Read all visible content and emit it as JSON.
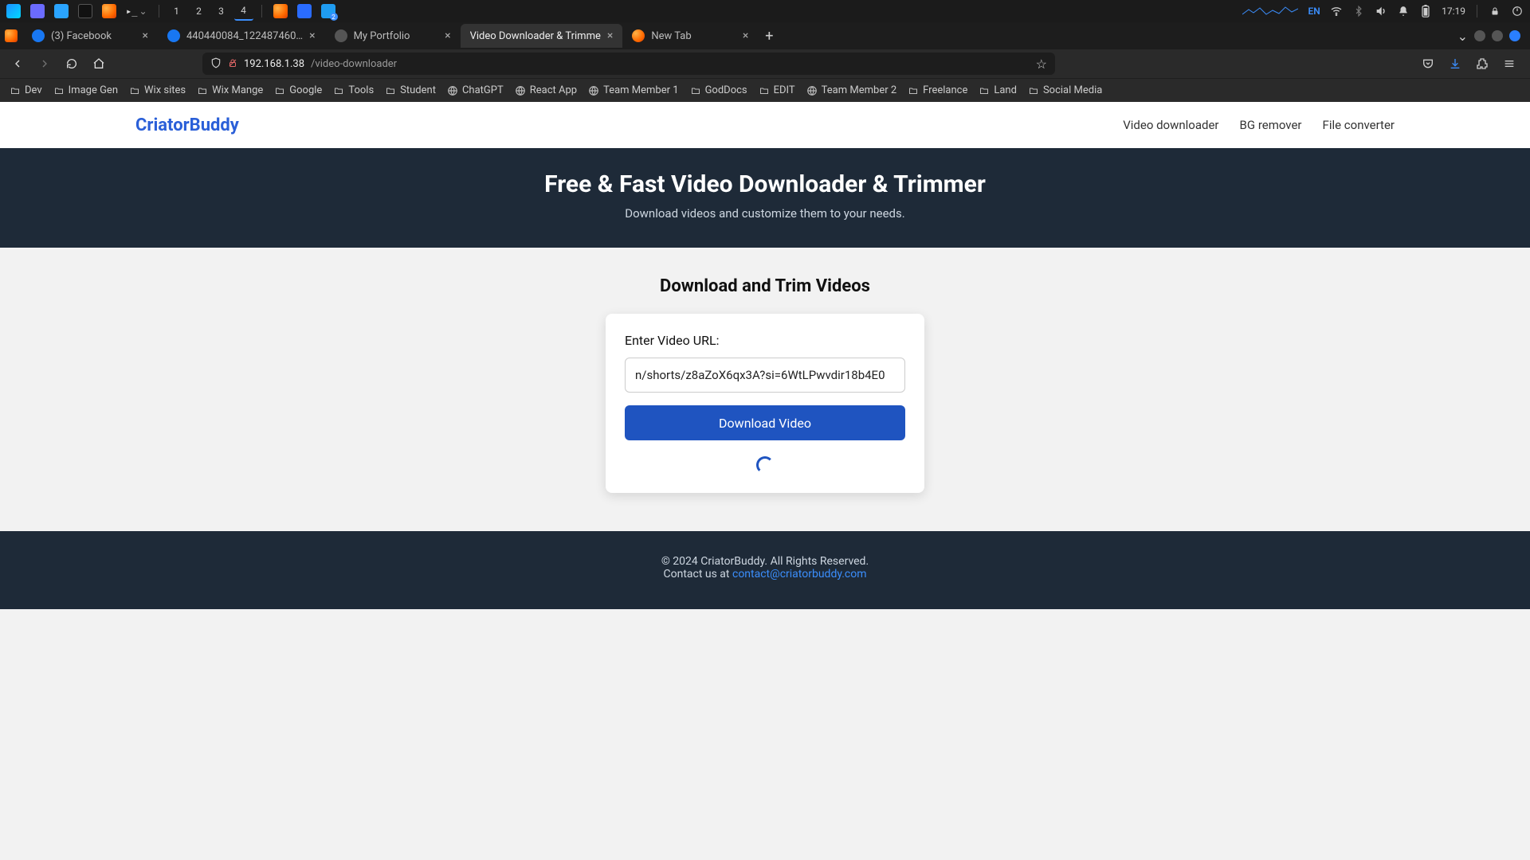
{
  "os": {
    "workspaces": [
      "1",
      "2",
      "3",
      "4"
    ],
    "active_workspace": "4",
    "lang": "EN",
    "time": "17:19"
  },
  "browser": {
    "tabs": [
      {
        "title": "(3) Facebook",
        "favicon": "#1877f2",
        "closable": true
      },
      {
        "title": "440440084_122487460…",
        "favicon": "#1877f2",
        "closable": true
      },
      {
        "title": "My Portfolio",
        "favicon": "",
        "closable": true
      },
      {
        "title": "Video Downloader & Trimme",
        "favicon": "",
        "closable": true,
        "active": true
      },
      {
        "title": "New Tab",
        "favicon": "#ff7a1a",
        "closable": true
      }
    ],
    "url_domain": "192.168.1.38",
    "url_path": "/video-downloader",
    "bookmarks": [
      {
        "label": "Dev",
        "kind": "folder"
      },
      {
        "label": "Image Gen",
        "kind": "folder"
      },
      {
        "label": "Wix sites",
        "kind": "folder"
      },
      {
        "label": "Wix Mange",
        "kind": "folder"
      },
      {
        "label": "Google",
        "kind": "folder"
      },
      {
        "label": "Tools",
        "kind": "folder"
      },
      {
        "label": "Student",
        "kind": "folder"
      },
      {
        "label": "ChatGPT",
        "kind": "icon"
      },
      {
        "label": "React App",
        "kind": "icon"
      },
      {
        "label": "Team Member 1",
        "kind": "icon"
      },
      {
        "label": "GodDocs",
        "kind": "folder"
      },
      {
        "label": "EDIT",
        "kind": "folder"
      },
      {
        "label": "Team Member 2",
        "kind": "icon"
      },
      {
        "label": "Freelance",
        "kind": "folder"
      },
      {
        "label": "Land",
        "kind": "folder"
      },
      {
        "label": "Social Media",
        "kind": "folder"
      }
    ]
  },
  "site": {
    "brand": "CriatorBuddy",
    "nav": [
      "Video downloader",
      "BG remover",
      "File converter"
    ],
    "hero_title": "Free & Fast Video Downloader & Trimmer",
    "hero_sub": "Download videos and customize them to your needs.",
    "section_title": "Download and Trim Videos",
    "input_label": "Enter Video URL:",
    "input_value": "n/shorts/z8aZoX6qx3A?si=6WtLPwvdir18b4E0",
    "button": "Download Video",
    "footer_copy": "© 2024 CriatorBuddy. All Rights Reserved.",
    "footer_contact_prefix": "Contact us at ",
    "footer_email": "contact@criatorbuddy.com"
  }
}
